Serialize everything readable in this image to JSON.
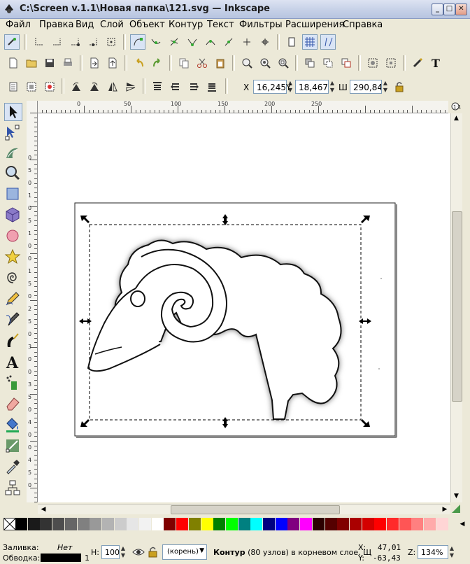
{
  "window": {
    "title": "C:\\Screen v.1.1\\Новая папка\\121.svg — Inkscape",
    "minimize": "_",
    "maximize": "□",
    "close": "✕"
  },
  "menu": [
    "Файл",
    "Правка",
    "Вид",
    "Слой",
    "Объект",
    "Контур",
    "Текст",
    "Фильтры",
    "Расширения",
    "Справка"
  ],
  "toolbar": {
    "x_label": "X",
    "x_value": "16,245",
    "y_label": "Y",
    "y_value": "18,467",
    "w_label": "Ш",
    "w_value": "290,840"
  },
  "ruler": {
    "h_ticks": [
      "0",
      "50",
      "100",
      "150",
      "200",
      "250"
    ],
    "v_ticks": [
      "0",
      "5",
      "0",
      "1",
      "0",
      "5",
      "1",
      "0",
      "0",
      "1",
      "5",
      "0",
      "2",
      "5",
      "0",
      "3",
      "0",
      "0",
      "3",
      "5",
      "0",
      "4",
      "0",
      "0",
      "4",
      "5",
      "0"
    ]
  },
  "colors": {
    "accent": "#316ac5",
    "selection": "#000000"
  },
  "palette": [
    "#000000",
    "#1a1a1a",
    "#333333",
    "#4d4d4d",
    "#666666",
    "#808080",
    "#999999",
    "#b3b3b3",
    "#cccccc",
    "#e6e6e6",
    "#f2f2f2",
    "#ffffff",
    "#800000",
    "#ff0000",
    "#808000",
    "#ffff00",
    "#008000",
    "#00ff00",
    "#008080",
    "#00ffff",
    "#000080",
    "#0000ff",
    "#800080",
    "#ff00ff",
    "#2b0000",
    "#550000",
    "#800000",
    "#aa0000",
    "#d40000",
    "#ff0000",
    "#ff2a2a",
    "#ff5555",
    "#ff8080",
    "#ffaaaa",
    "#ffd5d5"
  ],
  "status": {
    "fill_label": "Заливка:",
    "fill_value": "Нет",
    "stroke_label": "Обводка:",
    "stroke_width": "1",
    "opacity_label": "Н:",
    "opacity_value": "100",
    "layer_value": "(корень)",
    "message_bold": "Контур",
    "message_rest": " (80 узлов) в корневом слое. Щ",
    "x_label": "X:",
    "x_value": "47,01",
    "y_label": "Y:",
    "y_value": "-63,43",
    "z_label": "Z:",
    "zoom_value": "134%"
  }
}
